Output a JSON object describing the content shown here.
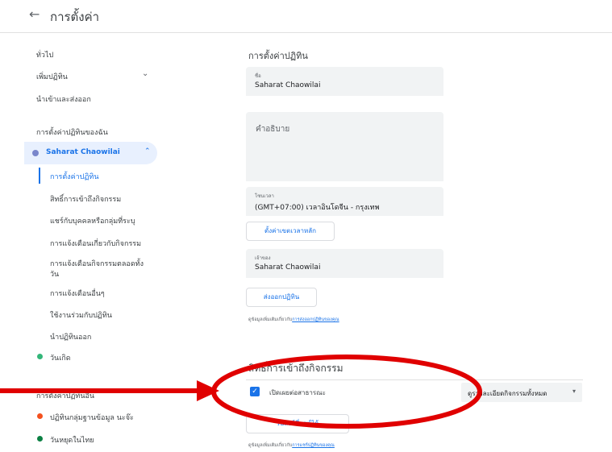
{
  "header": {
    "back_icon": "arrow-left-icon",
    "title": "การตั้งค่า"
  },
  "sidebar": {
    "general": "ทั่วไป",
    "add_calendar": "เพิ่มปฏิทิน",
    "import_export": "นำเข้าและส่งออก",
    "my_calendars_header": "การตั้งค่าปฏิทินของฉัน",
    "selected_calendar": "Saharat Chaowilai",
    "sub_items": [
      "การตั้งค่าปฏิทิน",
      "สิทธิ์การเข้าถึงกิจกรรม",
      "แชร์กับบุคคลหรือกลุ่มที่ระบุ",
      "การแจ้งเตือนเกี่ยวกับกิจกรรม",
      "การแจ้งเตือนกิจกรรมตลอดทั้ง",
      "วัน",
      "การแจ้งเตือนอื่นๆ",
      "ใช้งานร่วมกับปฏิทิน",
      "นำปฏิทินออก"
    ],
    "birthday": "วันเกิด",
    "other_calendars_header": "การตั้งค่าปฏิทินอื่น",
    "other_items": [
      "ปฏิทินกลุ่มฐานข้อมูล นะจ๊ะ",
      "วันหยุดในไทย"
    ],
    "colors": {
      "selected_dot": "#7986cb",
      "birthday": "#33b679",
      "group_calendar": "#f4511e",
      "holidays": "#0b8043",
      "accent": "#1a73e8"
    }
  },
  "main": {
    "section_title": "การตั้งค่าปฏิทิน",
    "name_label": "ชื่อ",
    "name_value": "Saharat Chaowilai",
    "description_placeholder": "คำอธิบาย",
    "timezone_label": "โซนเวลา",
    "timezone_value": "(GMT+07:00) เวลาอินโดจีน - กรุงเทพ",
    "set_primary_timezone_button": "ตั้งค่าเขตเวลาหลัก",
    "owner_label": "เจ้าของ",
    "owner_value": "Saharat Chaowilai",
    "export_button": "ส่งออกปฏิทิน",
    "export_note_prefix": "ดูข้อมูลเพิ่มเติมเกี่ยวกับ",
    "export_note_link": "การส่งออกปฏิทินของคุณ",
    "access_title": "สิทธิ์การเข้าถึงกิจกรรม",
    "make_public_label": "เปิดเผยต่อสาธารณะ",
    "make_public_checked": true,
    "visibility_value": "ดูรายละเอียดกิจกรรมทั้งหมด",
    "shareable_link_button": "รับลิงก์ที่แชร์ได้",
    "share_note_prefix": "ดูข้อมูลเพิ่มเติมเกี่ยวกับ",
    "share_note_link": "การแชร์ปฏิทินของคุณ"
  },
  "annotations": {
    "arrow_color": "#e00000",
    "ellipse_color": "#e00000"
  }
}
